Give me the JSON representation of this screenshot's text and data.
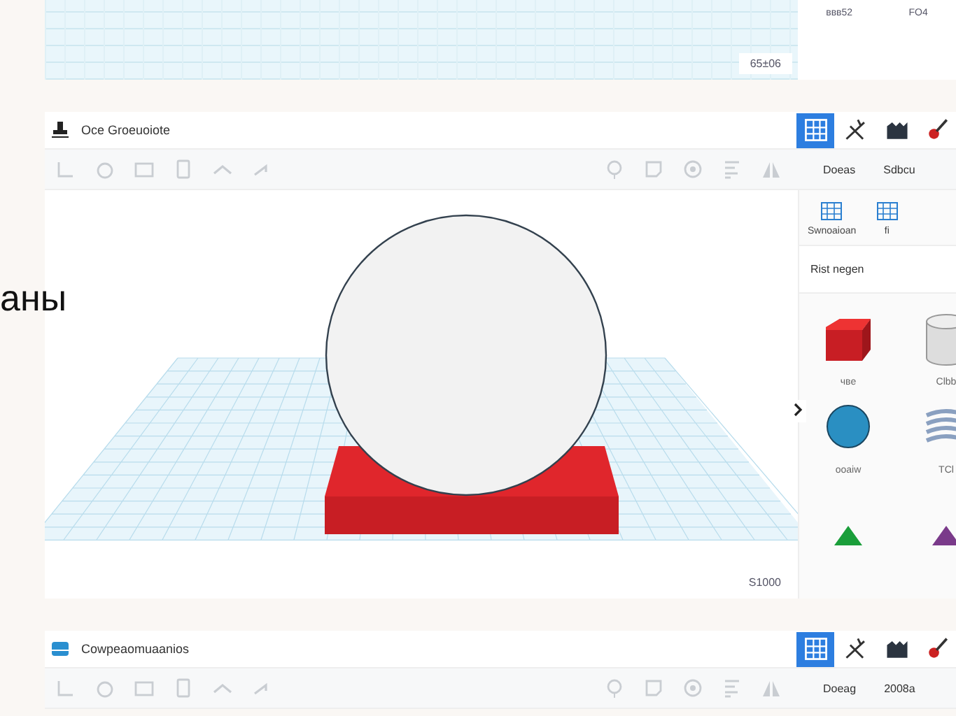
{
  "overlay_text": "аны",
  "top_panel": {
    "viewport_label": "65±06",
    "shape_labels": [
      "ввв52",
      "FO4"
    ]
  },
  "main_panel": {
    "title": "Oce Groeuoiote",
    "view_buttons": [
      {
        "selected": true
      },
      {
        "selected": false
      },
      {
        "selected": false
      },
      {
        "selected": false
      }
    ],
    "side_tabs": [
      "Doeas",
      "Sdbcu"
    ],
    "viewport_label": "S1000",
    "sidebar": {
      "tools": [
        "Swnoaioan",
        "fi"
      ],
      "dropdown": "Rist negen",
      "shapes": [
        {
          "kind": "cube",
          "label": "чве"
        },
        {
          "kind": "cylinder",
          "label": "Clbb"
        },
        {
          "kind": "sphere",
          "label": "ooaiw"
        },
        {
          "kind": "spring",
          "label": "TCl"
        },
        {
          "kind": "pyramid"
        },
        {
          "kind": "cone"
        }
      ]
    }
  },
  "bottom_panel": {
    "title": "Cowpeaomuaanios",
    "view_buttons": [
      {
        "selected": true
      },
      {
        "selected": false
      },
      {
        "selected": false
      },
      {
        "selected": false
      }
    ],
    "side_tabs": [
      "Doeag",
      "2008a"
    ]
  }
}
